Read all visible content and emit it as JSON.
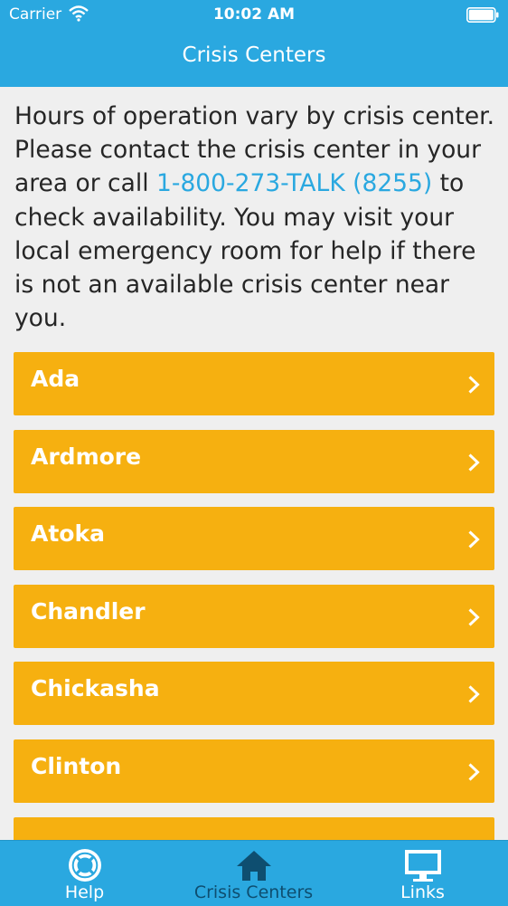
{
  "status_bar": {
    "carrier": "Carrier",
    "time": "10:02 AM"
  },
  "nav": {
    "title": "Crisis Centers"
  },
  "intro": {
    "text_before": "Hours of operation vary by crisis center. Please contact the crisis center in your area or call ",
    "phone_link": "1-800-273-TALK (8255)",
    "text_after": " to check availability. You may visit your local emergency room for help if there is not an available crisis center near you."
  },
  "centers": [
    "Ada",
    "Ardmore",
    "Atoka",
    "Chandler",
    "Chickasha",
    "Clinton"
  ],
  "tabs": [
    {
      "label": "Help",
      "icon": "lifebuoy-icon",
      "active": false
    },
    {
      "label": "Crisis Centers",
      "icon": "home-icon",
      "active": true
    },
    {
      "label": "Links",
      "icon": "monitor-icon",
      "active": false
    }
  ],
  "colors": {
    "brand_blue": "#2aa8e0",
    "row_orange": "#f6b010",
    "active_tab": "#0e4e70"
  }
}
